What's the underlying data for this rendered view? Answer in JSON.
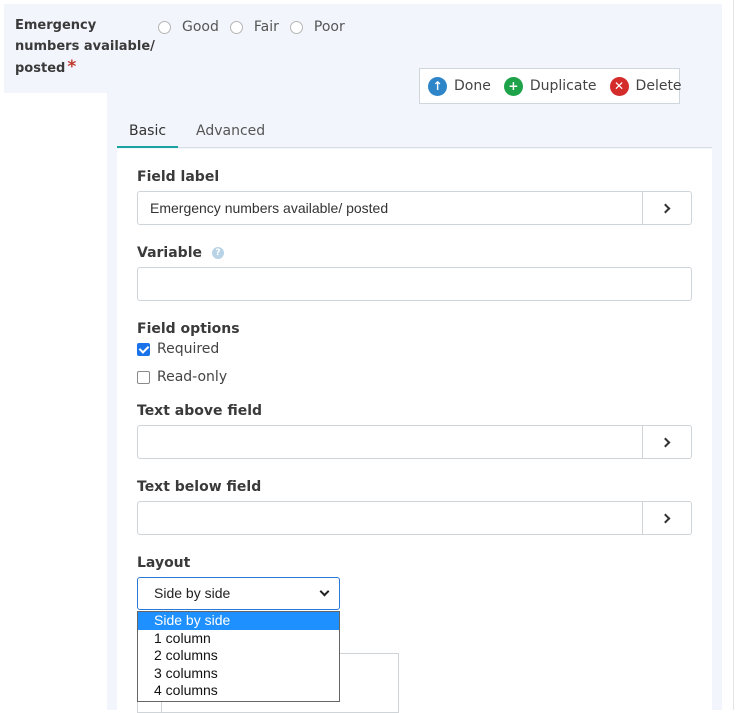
{
  "preview": {
    "label_lines": [
      "Emergency",
      "numbers available/",
      "posted"
    ],
    "required_mark": "*",
    "rating_options": [
      "Good",
      "Fair",
      "Poor"
    ]
  },
  "actions": {
    "done": "Done",
    "duplicate": "Duplicate",
    "delete": "Delete"
  },
  "tabs": {
    "basic": "Basic",
    "advanced": "Advanced"
  },
  "form": {
    "field_label": {
      "label": "Field label",
      "value": "Emergency numbers available/ posted"
    },
    "variable": {
      "label": "Variable",
      "value": ""
    },
    "field_options": {
      "label": "Field options",
      "required": {
        "label": "Required",
        "checked": true
      },
      "readonly": {
        "label": "Read-only",
        "checked": false
      }
    },
    "text_above": {
      "label": "Text above field",
      "value": ""
    },
    "text_below": {
      "label": "Text below field",
      "value": ""
    },
    "layout": {
      "label": "Layout",
      "selected": "Side by side",
      "options": [
        "Side by side",
        "1 column",
        "2 columns",
        "3 columns",
        "4 columns"
      ]
    }
  },
  "colors": {
    "accent_tab": "#1aa3a0",
    "done_icon": "#2e86c9",
    "duplicate_icon": "#1ea34a",
    "delete_icon": "#d42b2b",
    "checkbox": "#1a73e8",
    "dropdown_highlight": "#1e90ff"
  }
}
